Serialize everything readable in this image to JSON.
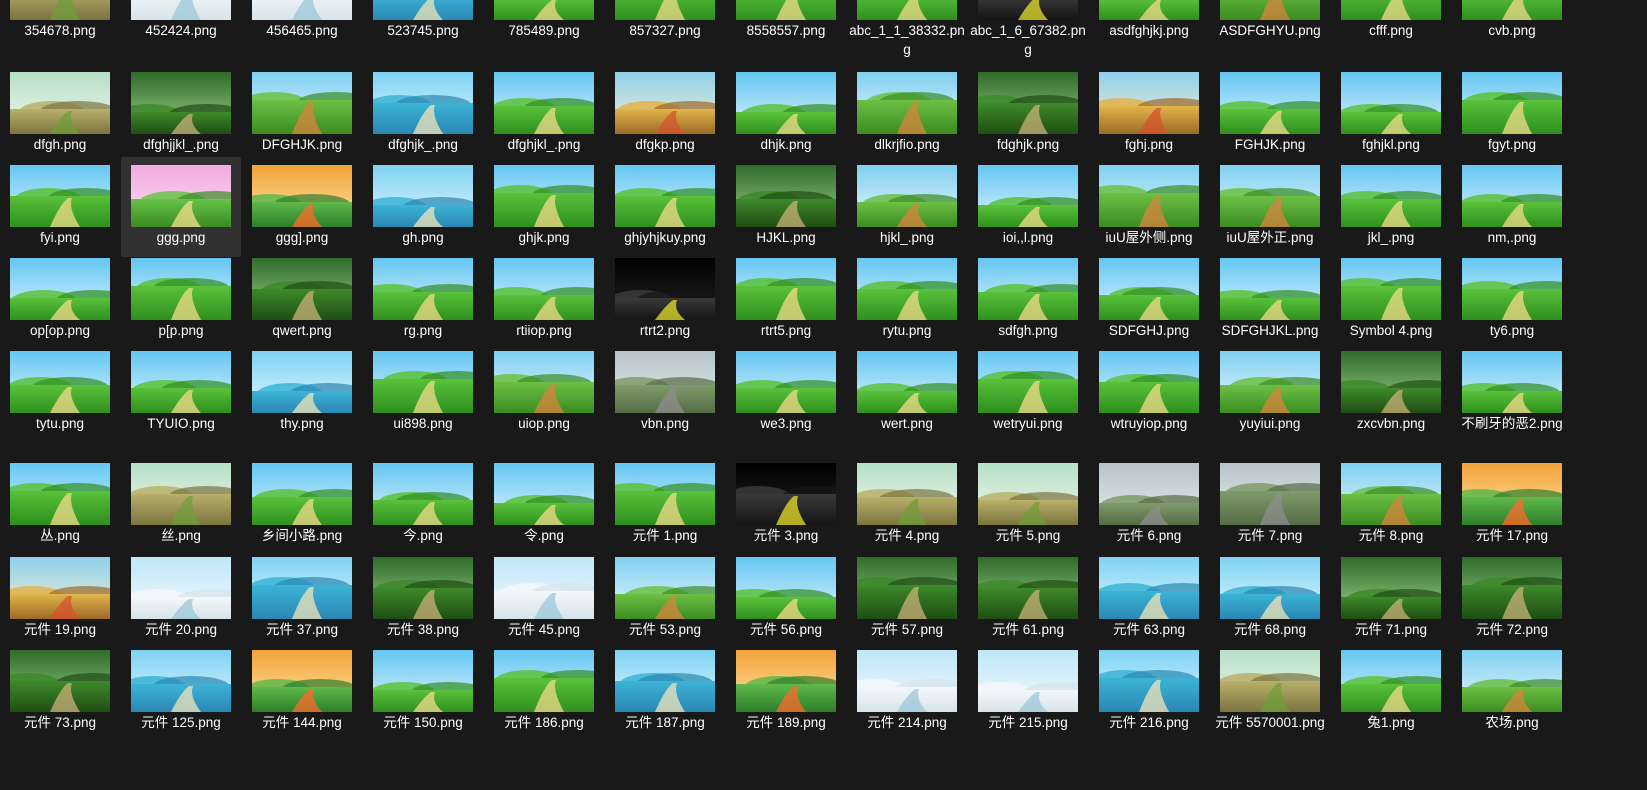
{
  "window": {
    "view": "file-explorer-large-icons",
    "selected_file": "ggg.png"
  },
  "colors": {
    "background": "#191919",
    "selected_tile": "#313131",
    "label_text": "#ffffff"
  },
  "files": [
    {
      "name": "354678.png",
      "theme": "ground"
    },
    {
      "name": "452424.png",
      "theme": "snow"
    },
    {
      "name": "456465.png",
      "theme": "snow"
    },
    {
      "name": "523745.png",
      "theme": "water"
    },
    {
      "name": "785489.png",
      "theme": "meadow"
    },
    {
      "name": "857327.png",
      "theme": "meadow"
    },
    {
      "name": "8558557.png",
      "theme": "meadow"
    },
    {
      "name": "abc_1_1_38332.png",
      "theme": "meadow"
    },
    {
      "name": "abc_1_6_67382.png",
      "theme": "night"
    },
    {
      "name": "asdfghjkj.png",
      "theme": "meadow"
    },
    {
      "name": "ASDFGHYU.png",
      "theme": "house"
    },
    {
      "name": "cfff.png",
      "theme": "meadow"
    },
    {
      "name": "cvb.png",
      "theme": "meadow"
    },
    {
      "name": "dfgh.png",
      "theme": "ground"
    },
    {
      "name": "dfghjjkl_.png",
      "theme": "forest"
    },
    {
      "name": "DFGHJK.png",
      "theme": "house"
    },
    {
      "name": "dfghjk_.png",
      "theme": "water"
    },
    {
      "name": "dfghjkl_.png",
      "theme": "meadow"
    },
    {
      "name": "dfgkp.png",
      "theme": "autumn"
    },
    {
      "name": "dhjk.png",
      "theme": "meadow"
    },
    {
      "name": "dlkrjfio.png",
      "theme": "house"
    },
    {
      "name": "fdghjk.png",
      "theme": "forest"
    },
    {
      "name": "fghj.png",
      "theme": "autumn"
    },
    {
      "name": "FGHJK.png",
      "theme": "meadow"
    },
    {
      "name": "fghjkl.png",
      "theme": "meadow"
    },
    {
      "name": "fgyt.png",
      "theme": "meadow"
    },
    {
      "name": "fyi.png",
      "theme": "meadow"
    },
    {
      "name": "ggg.png",
      "theme": "pink"
    },
    {
      "name": "ggg].png",
      "theme": "sunset"
    },
    {
      "name": "gh.png",
      "theme": "water"
    },
    {
      "name": "ghjk.png",
      "theme": "meadow"
    },
    {
      "name": "ghjyhjkuy.png",
      "theme": "meadow"
    },
    {
      "name": "HJKL.png",
      "theme": "forest"
    },
    {
      "name": "hjkl_.png",
      "theme": "house"
    },
    {
      "name": "ioi,,l.png",
      "theme": "meadow"
    },
    {
      "name": "iuU屋外侧.png",
      "theme": "house"
    },
    {
      "name": "iuU屋外正.png",
      "theme": "house"
    },
    {
      "name": "jkl_.png",
      "theme": "meadow"
    },
    {
      "name": "nm,.png",
      "theme": "meadow"
    },
    {
      "name": "op[op.png",
      "theme": "meadow"
    },
    {
      "name": "p[p.png",
      "theme": "meadow"
    },
    {
      "name": "qwert.png",
      "theme": "forest"
    },
    {
      "name": "rg.png",
      "theme": "meadow"
    },
    {
      "name": "rtiiop.png",
      "theme": "meadow"
    },
    {
      "name": "rtrt2.png",
      "theme": "night"
    },
    {
      "name": "rtrt5.png",
      "theme": "meadow"
    },
    {
      "name": "rytu.png",
      "theme": "meadow"
    },
    {
      "name": "sdfgh.png",
      "theme": "meadow"
    },
    {
      "name": "SDFGHJ.png",
      "theme": "meadow"
    },
    {
      "name": "SDFGHJKL.png",
      "theme": "meadow"
    },
    {
      "name": "Symbol 4.png",
      "theme": "meadow"
    },
    {
      "name": "ty6.png",
      "theme": "meadow"
    },
    {
      "name": "tytu.png",
      "theme": "meadow"
    },
    {
      "name": "TYUIO.png",
      "theme": "meadow"
    },
    {
      "name": "thy.png",
      "theme": "water"
    },
    {
      "name": "ui898.png",
      "theme": "meadow"
    },
    {
      "name": "uiop.png",
      "theme": "house"
    },
    {
      "name": "vbn.png",
      "theme": "grey"
    },
    {
      "name": "we3.png",
      "theme": "meadow"
    },
    {
      "name": "wert.png",
      "theme": "meadow"
    },
    {
      "name": "wetryui.png",
      "theme": "meadow"
    },
    {
      "name": "wtruyiop.png",
      "theme": "meadow"
    },
    {
      "name": "yuyiui.png",
      "theme": "house"
    },
    {
      "name": "zxcvbn.png",
      "theme": "forest"
    },
    {
      "name": "不刷牙的恶2.png",
      "theme": "meadow"
    },
    {
      "name": "丛.png",
      "theme": "meadow"
    },
    {
      "name": "丝.png",
      "theme": "ground"
    },
    {
      "name": "乡间小路.png",
      "theme": "meadow"
    },
    {
      "name": "今.png",
      "theme": "meadow"
    },
    {
      "name": "令.png",
      "theme": "meadow"
    },
    {
      "name": "元件 1.png",
      "theme": "meadow"
    },
    {
      "name": "元件 3.png",
      "theme": "night"
    },
    {
      "name": "元件 4.png",
      "theme": "ground"
    },
    {
      "name": "元件 5.png",
      "theme": "ground"
    },
    {
      "name": "元件 6.png",
      "theme": "grey"
    },
    {
      "name": "元件 7.png",
      "theme": "grey"
    },
    {
      "name": "元件 8.png",
      "theme": "house"
    },
    {
      "name": "元件 17.png",
      "theme": "sunset"
    },
    {
      "name": "元件 19.png",
      "theme": "autumn"
    },
    {
      "name": "元件 20.png",
      "theme": "snow"
    },
    {
      "name": "元件 37.png",
      "theme": "water"
    },
    {
      "name": "元件 38.png",
      "theme": "forest"
    },
    {
      "name": "元件 45.png",
      "theme": "snow"
    },
    {
      "name": "元件 53.png",
      "theme": "house"
    },
    {
      "name": "元件 56.png",
      "theme": "meadow"
    },
    {
      "name": "元件 57.png",
      "theme": "forest"
    },
    {
      "name": "元件 61.png",
      "theme": "forest"
    },
    {
      "name": "元件 63.png",
      "theme": "water"
    },
    {
      "name": "元件 68.png",
      "theme": "water"
    },
    {
      "name": "元件 71.png",
      "theme": "forest"
    },
    {
      "name": "元件 72.png",
      "theme": "forest"
    },
    {
      "name": "元件 73.png",
      "theme": "forest"
    },
    {
      "name": "元件 125.png",
      "theme": "water"
    },
    {
      "name": "元件 144.png",
      "theme": "sunset"
    },
    {
      "name": "元件 150.png",
      "theme": "meadow"
    },
    {
      "name": "元件 186.png",
      "theme": "meadow"
    },
    {
      "name": "元件 187.png",
      "theme": "water"
    },
    {
      "name": "元件 189.png",
      "theme": "sunset"
    },
    {
      "name": "元件 214.png",
      "theme": "snow"
    },
    {
      "name": "元件 215.png",
      "theme": "snow"
    },
    {
      "name": "元件 216.png",
      "theme": "water"
    },
    {
      "name": "元件 5570001.png",
      "theme": "ground"
    },
    {
      "name": "兔1.png",
      "theme": "meadow"
    },
    {
      "name": "农场.png",
      "theme": "house"
    }
  ]
}
